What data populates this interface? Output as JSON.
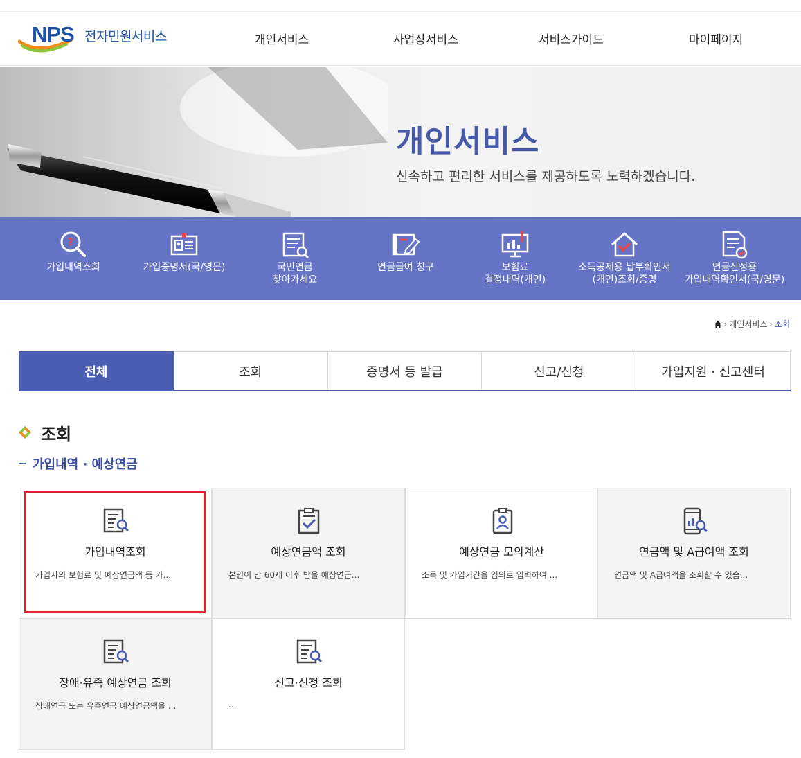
{
  "header": {
    "logo_text": "NPS",
    "logo_subtitle": "전자민원서비스",
    "nav": [
      "개인서비스",
      "사업장서비스",
      "서비스가이드",
      "마이페이지"
    ]
  },
  "hero": {
    "title": "개인서비스",
    "subtitle": "신속하고 편리한 서비스를 제공하도록 노력하겠습니다."
  },
  "quick_menu": [
    {
      "label": "가입내역조회",
      "icon": "search-question-icon"
    },
    {
      "label": "가입증명서(국/영문)",
      "icon": "id-card-icon"
    },
    {
      "label": "국민연금\n찾아가세요",
      "icon": "document-search-icon"
    },
    {
      "label": "연금급여 청구",
      "icon": "document-edit-icon"
    },
    {
      "label": "보험료\n결정내역(개인)",
      "icon": "monitor-chart-icon"
    },
    {
      "label": "소득공제용 납부확인서\n(개인)조회/증명",
      "icon": "house-check-icon"
    },
    {
      "label": "연금산정용\n가입내역확인서(국/영문)",
      "icon": "document-check-icon"
    }
  ],
  "breadcrumb": {
    "home_icon": "home-icon",
    "items": [
      "개인서비스",
      "조회"
    ]
  },
  "tabs": [
    "전체",
    "조회",
    "증명서 등 발급",
    "신고/신청",
    "가입지원 · 신고센터"
  ],
  "active_tab": "전체",
  "section": {
    "title": "조회",
    "subtitle": "가입내역 · 예상연금"
  },
  "cards": [
    {
      "title": "가입내역조회",
      "desc": "가입자의 보험료 및 예상연금액 등 가...",
      "icon": "document-search-icon"
    },
    {
      "title": "예상연금액 조회",
      "desc": "본인이 만 60세 이후 받을 예상연금...",
      "icon": "clipboard-check-icon"
    },
    {
      "title": "예상연금 모의계산",
      "desc": "소득 및 가입기간을 임의로 입력하여 ...",
      "icon": "person-card-icon"
    },
    {
      "title": "연금액 및 A급여액 조회",
      "desc": "연금액 및 A급여액을 조회할 수 있습...",
      "icon": "mobile-chart-search-icon"
    },
    {
      "title": "장애·유족 예상연금 조회",
      "desc": "장애연금 또는 유족연금 예상연금액을 ...",
      "icon": "document-search-icon"
    },
    {
      "title": "신고·신청 조회",
      "desc": "...",
      "icon": "document-search-icon"
    }
  ],
  "colors": {
    "brand": "#1f54a6",
    "accent": "#4a5db0",
    "quick_bg": "#6674c6",
    "highlight": "#e0202a"
  }
}
